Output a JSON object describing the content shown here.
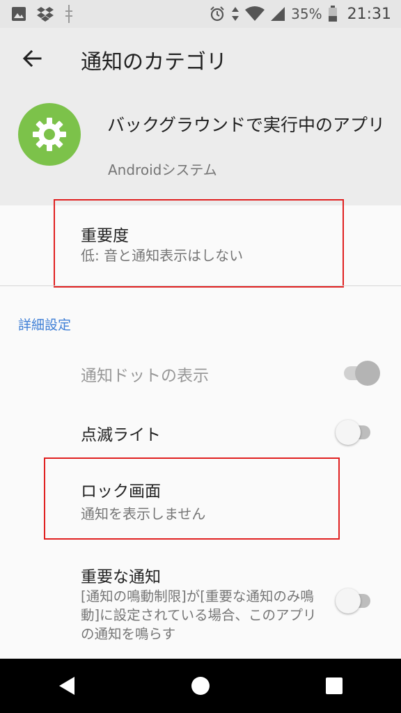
{
  "status_bar": {
    "icons_left": [
      "image-icon",
      "dropbox-icon",
      "usb-icon"
    ],
    "icons_right": [
      "alarm-icon",
      "data-arrows-icon",
      "wifi-icon",
      "signal-icon",
      "battery-icon"
    ],
    "battery": "35%",
    "time": "21:31"
  },
  "header": {
    "title": "通知のカテゴリ",
    "app_name": "バックグラウンドで実行中のアプリ",
    "app_subtitle": "Androidシステム",
    "app_icon": "gear-icon",
    "app_icon_color": "#7cc24a"
  },
  "importance": {
    "title": "重要度",
    "summary": "低: 音と通知表示はしない"
  },
  "section": {
    "label": "詳細設定",
    "color": "#3f7fd6"
  },
  "settings": {
    "notification_dot": {
      "title": "通知ドットの表示",
      "enabled": false,
      "state": "on"
    },
    "blink_light": {
      "title": "点滅ライト",
      "state": "off"
    },
    "lock_screen": {
      "title": "ロック画面",
      "summary": "通知を表示しません"
    },
    "important_notification": {
      "title": "重要な通知",
      "summary": "[通知の鳴動制限]が[重要な通知のみ鳴動]に設定されている場合、このアプリの通知を鳴らす",
      "state": "off"
    }
  },
  "nav_bar": {
    "buttons": [
      "back-icon",
      "home-icon",
      "recents-icon"
    ]
  },
  "annotation_color": "#e02020"
}
